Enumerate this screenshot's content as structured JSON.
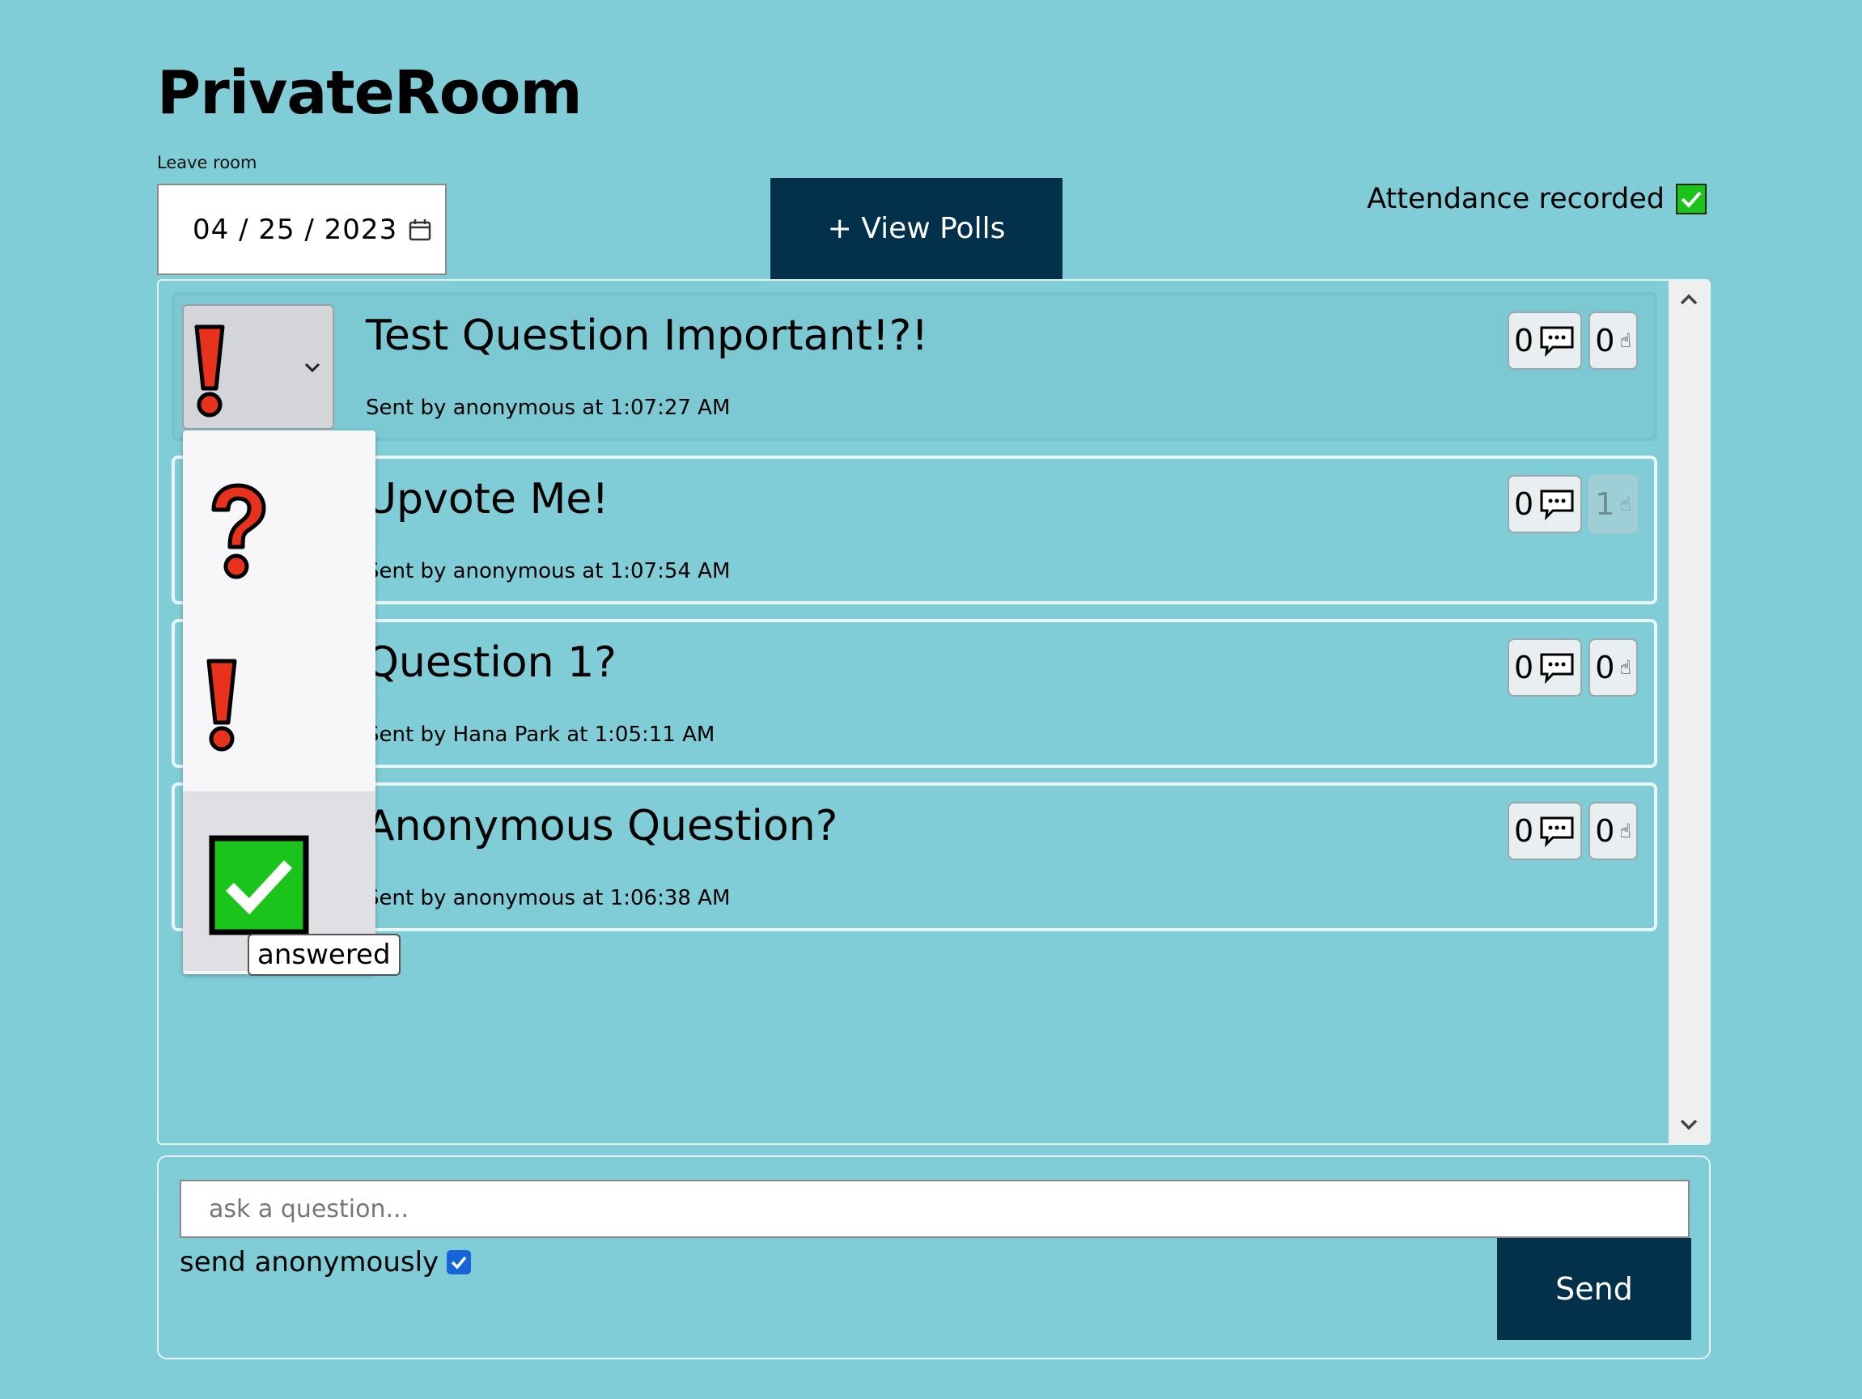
{
  "room": {
    "title": "PrivateRoom",
    "leave_label": "Leave room"
  },
  "date": {
    "value": "04 / 25 / 2023"
  },
  "polls_button": {
    "label": "+ View Polls"
  },
  "attendance": {
    "label": "Attendance recorded",
    "checked": true
  },
  "questions": [
    {
      "title": "Test Question Important!?!",
      "meta": "Sent by anonymous at 1:07:27 AM",
      "comments": "0",
      "upvotes": "0",
      "status": "important"
    },
    {
      "title": "Upvote Me!",
      "meta": "Sent by anonymous at 1:07:54 AM",
      "comments": "0",
      "upvotes": "1",
      "upvote_disabled": true
    },
    {
      "title": "Question 1?",
      "meta": "Sent by Hana Park at 1:05:11 AM",
      "comments": "0",
      "upvotes": "0"
    },
    {
      "title": "Anonymous Question?",
      "meta": "Sent by anonymous at 1:06:38 AM",
      "comments": "0",
      "upvotes": "0"
    }
  ],
  "status_menu": {
    "selected": "important",
    "options": [
      "question",
      "important",
      "answered"
    ],
    "hovered": "answered",
    "tooltip": "answered"
  },
  "composer": {
    "placeholder": "ask a question...",
    "anonymous_label": "send anonymously",
    "anonymous_checked": true,
    "send_label": "Send"
  },
  "colors": {
    "background": "#80cdd7",
    "button": "#03304a",
    "exclaim": "#e8321c",
    "answered_green": "#1bc41b",
    "checkbox_blue": "#1565d8"
  }
}
